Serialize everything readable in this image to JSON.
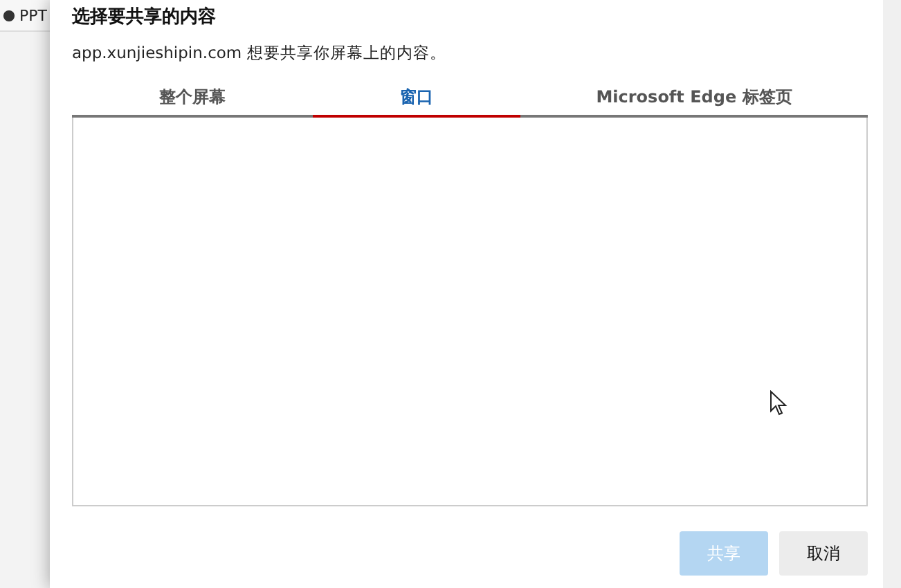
{
  "background_tab": {
    "title": "PPT"
  },
  "dialog": {
    "title": "选择要共享的内容",
    "subtitle": "app.xunjieshipin.com 想要共享你屏幕上的内容。",
    "tabs": [
      {
        "label": "整个屏幕",
        "selected": false
      },
      {
        "label": "窗口",
        "selected": true
      },
      {
        "label": "Microsoft Edge 标签页",
        "selected": false
      }
    ],
    "buttons": [
      {
        "label": "共享",
        "disabled": true
      },
      {
        "label": "取消",
        "disabled": false
      }
    ]
  }
}
